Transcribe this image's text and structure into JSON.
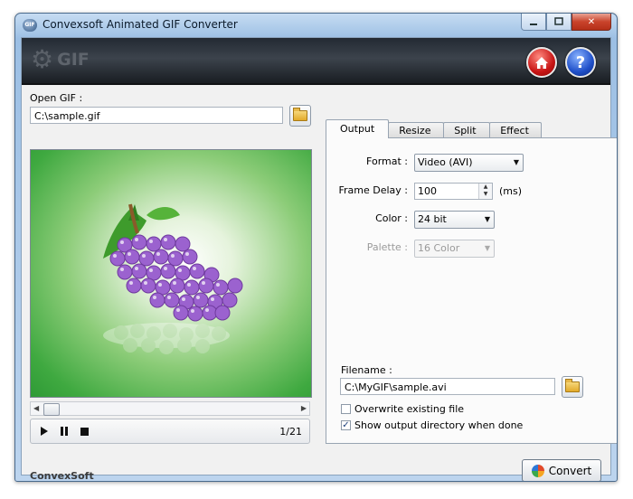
{
  "window": {
    "title": "Convexsoft Animated GIF Converter",
    "min_icon": "minimize-glyph",
    "max_icon": "maximize-glyph",
    "close_glyph": "✕"
  },
  "banner": {
    "logo_text": "GIF",
    "home_icon": "home-icon",
    "help_glyph": "?"
  },
  "input": {
    "label": "Open GIF :",
    "path": "C:\\sample.gif"
  },
  "player": {
    "frame_counter": "1/21"
  },
  "tabs": [
    "Output",
    "Resize",
    "Split",
    "Effect"
  ],
  "output": {
    "format_label": "Format :",
    "format_value": "Video (AVI)",
    "frame_delay_label": "Frame Delay :",
    "frame_delay_value": "100",
    "frame_delay_unit": "(ms)",
    "color_label": "Color :",
    "color_value": "24 bit",
    "palette_label": "Palette :",
    "palette_value": "16 Color",
    "filename_label": "Filename :",
    "filename_value": "C:\\MyGIF\\sample.avi",
    "overwrite_label": "Overwrite existing file",
    "overwrite_checked": false,
    "show_dir_label": "Show output directory when done",
    "show_dir_checked": true
  },
  "footer": {
    "brand": "ConvexSoft",
    "convert_label": "Convert"
  },
  "colors": {
    "banner": "#2a3038",
    "accent_red": "#c81515",
    "accent_blue": "#1f4fc9",
    "preview_green": "#3fa940",
    "grape_purple": "#8a4fc0"
  }
}
